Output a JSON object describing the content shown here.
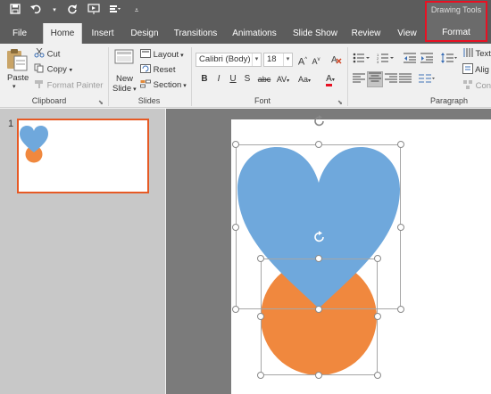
{
  "quick_access": {
    "save_icon": "save-icon",
    "undo_icon": "undo-icon",
    "redo_icon": "repeat-icon",
    "slideshow_icon": "start-from-beginning-icon",
    "touch_icon": "touch-mouse-mode-icon",
    "customize_icon": "customize-quick-access-icon"
  },
  "context_tab_group": {
    "label": "Drawing Tools"
  },
  "tabs": [
    {
      "label": "File"
    },
    {
      "label": "Home"
    },
    {
      "label": "Insert"
    },
    {
      "label": "Design"
    },
    {
      "label": "Transitions"
    },
    {
      "label": "Animations"
    },
    {
      "label": "Slide Show"
    },
    {
      "label": "Review"
    },
    {
      "label": "View"
    },
    {
      "label": "Format"
    }
  ],
  "active_tab": "Home",
  "clipboard": {
    "paste": "Paste",
    "cut": "Cut",
    "copy": "Copy",
    "format_painter": "Format Painter",
    "group_label": "Clipboard"
  },
  "slides": {
    "new_slide_1": "New",
    "new_slide_2": "Slide",
    "layout": "Layout",
    "reset": "Reset",
    "section": "Section",
    "group_label": "Slides"
  },
  "font": {
    "font_name": "Calibri (Body)",
    "font_size": "18",
    "bold": "B",
    "italic": "I",
    "underline": "U",
    "shadow": "S",
    "strikethrough": "abc",
    "spacing": "AV",
    "change_case": "Aa",
    "font_color": "A",
    "grow": "A",
    "shrink": "A",
    "group_label": "Font"
  },
  "paragraph": {
    "text_direction": "Text",
    "align_text": "Alig",
    "smartart": "Conv",
    "group_label": "Paragraph"
  },
  "thumbnail": {
    "slide_number": "1"
  },
  "colors": {
    "heart": "#6fa8dc",
    "circle": "#f0883e",
    "accent": "#d24726",
    "context_border": "#e81123"
  }
}
